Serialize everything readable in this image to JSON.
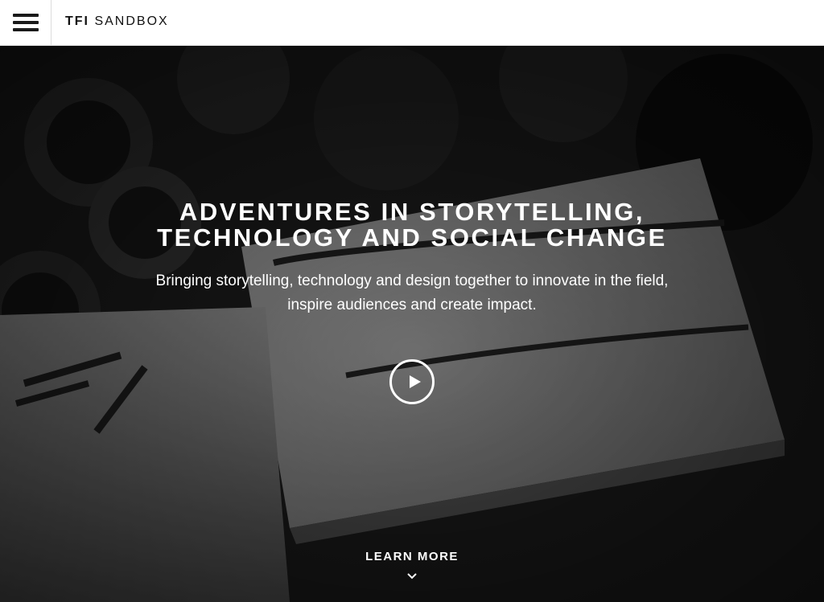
{
  "header": {
    "menu_icon": "hamburger-menu-icon",
    "brand_bold": "TFI",
    "brand_light": "SANDBOX"
  },
  "hero": {
    "title_line1": "ADVENTURES IN STORYTELLING,",
    "title_line2": "TECHNOLOGY AND SOCIAL CHANGE",
    "subtitle_line1": "Bringing storytelling, technology and design together to innovate in the field,",
    "subtitle_line2": "inspire audiences and create impact.",
    "play_icon": "play-icon",
    "learn_more_label": "LEARN MORE",
    "learn_more_icon": "chevron-down-icon"
  },
  "colors": {
    "header_bg": "#ffffff",
    "text_dark": "#111111",
    "hero_text": "#ffffff",
    "hero_bg": "#121212"
  }
}
